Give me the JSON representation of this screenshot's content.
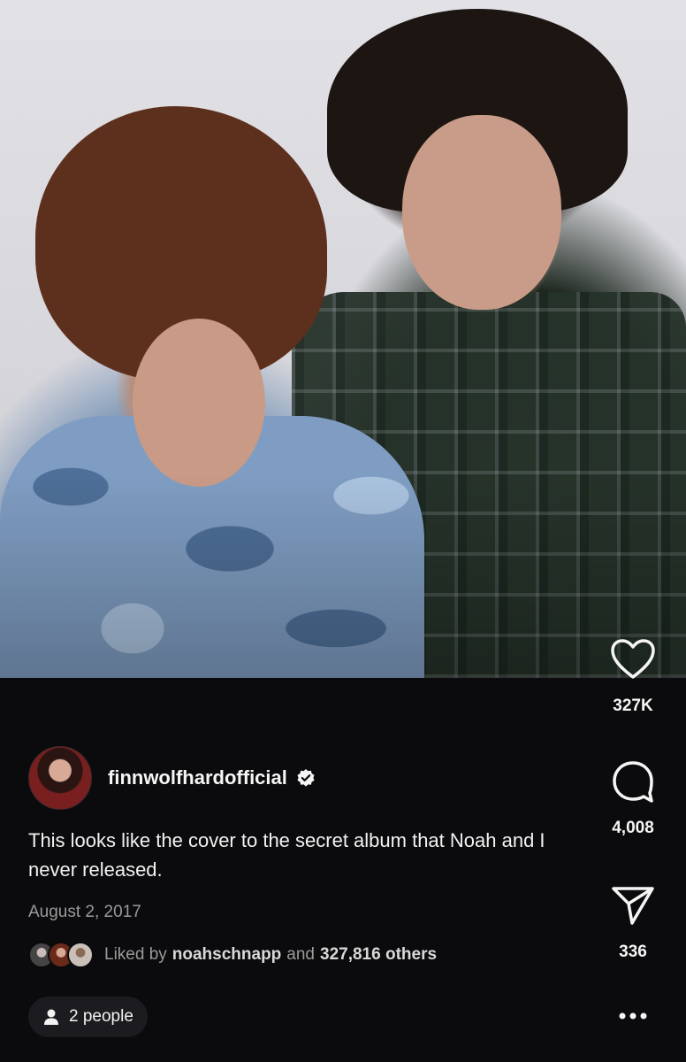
{
  "post": {
    "username": "finnwolfhardofficial",
    "caption": "This looks like the cover to the secret album that Noah and I never released.",
    "date": "August 2, 2017",
    "liked_by_prefix": "Liked by",
    "liked_by_user": "noahschnapp",
    "liked_by_and": "and",
    "liked_by_others": "327,816 others",
    "tagged_people": "2 people"
  },
  "actions": {
    "likes": "327K",
    "comments": "4,008",
    "shares": "336"
  },
  "icons": {
    "like": "heart-icon",
    "comment": "comment-bubble-icon",
    "share": "send-icon",
    "more": "more-options-icon",
    "verified": "verified-badge-icon",
    "tagged": "person-icon"
  },
  "colors": {
    "background": "#0b0b0d",
    "text": "#f5f5f5",
    "muted": "#9a9a9a",
    "pill": "#1c1c20"
  }
}
